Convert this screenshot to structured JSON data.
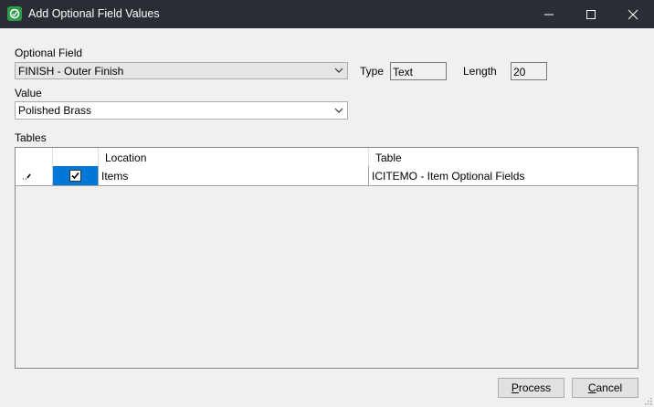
{
  "window": {
    "title": "Add Optional Field Values",
    "app_icon": "sage-app-icon",
    "controls": [
      "minimize-icon",
      "maximize-icon",
      "close-icon"
    ]
  },
  "optional_field": {
    "label": "Optional Field",
    "value": "FINISH -  Outer Finish"
  },
  "type": {
    "label": "Type",
    "value": "Text"
  },
  "length": {
    "label": "Length",
    "value": "20"
  },
  "value_field": {
    "label": "Value",
    "value": "Polished Brass"
  },
  "tables": {
    "label": "Tables",
    "columns": [
      "",
      "",
      "Location",
      "Table"
    ],
    "rows": [
      {
        "indicator": "pencil-edit-icon",
        "checked": true,
        "location": "Items",
        "table": "ICITEMO - Item Optional Fields"
      }
    ]
  },
  "buttons": {
    "process_prefix": "",
    "process_mnemonic": "P",
    "process_rest": "rocess",
    "cancel_prefix": "",
    "cancel_mnemonic": "C",
    "cancel_rest": "ancel"
  },
  "colors": {
    "titlebar": "#2b2d35",
    "selection": "#0078d7"
  }
}
